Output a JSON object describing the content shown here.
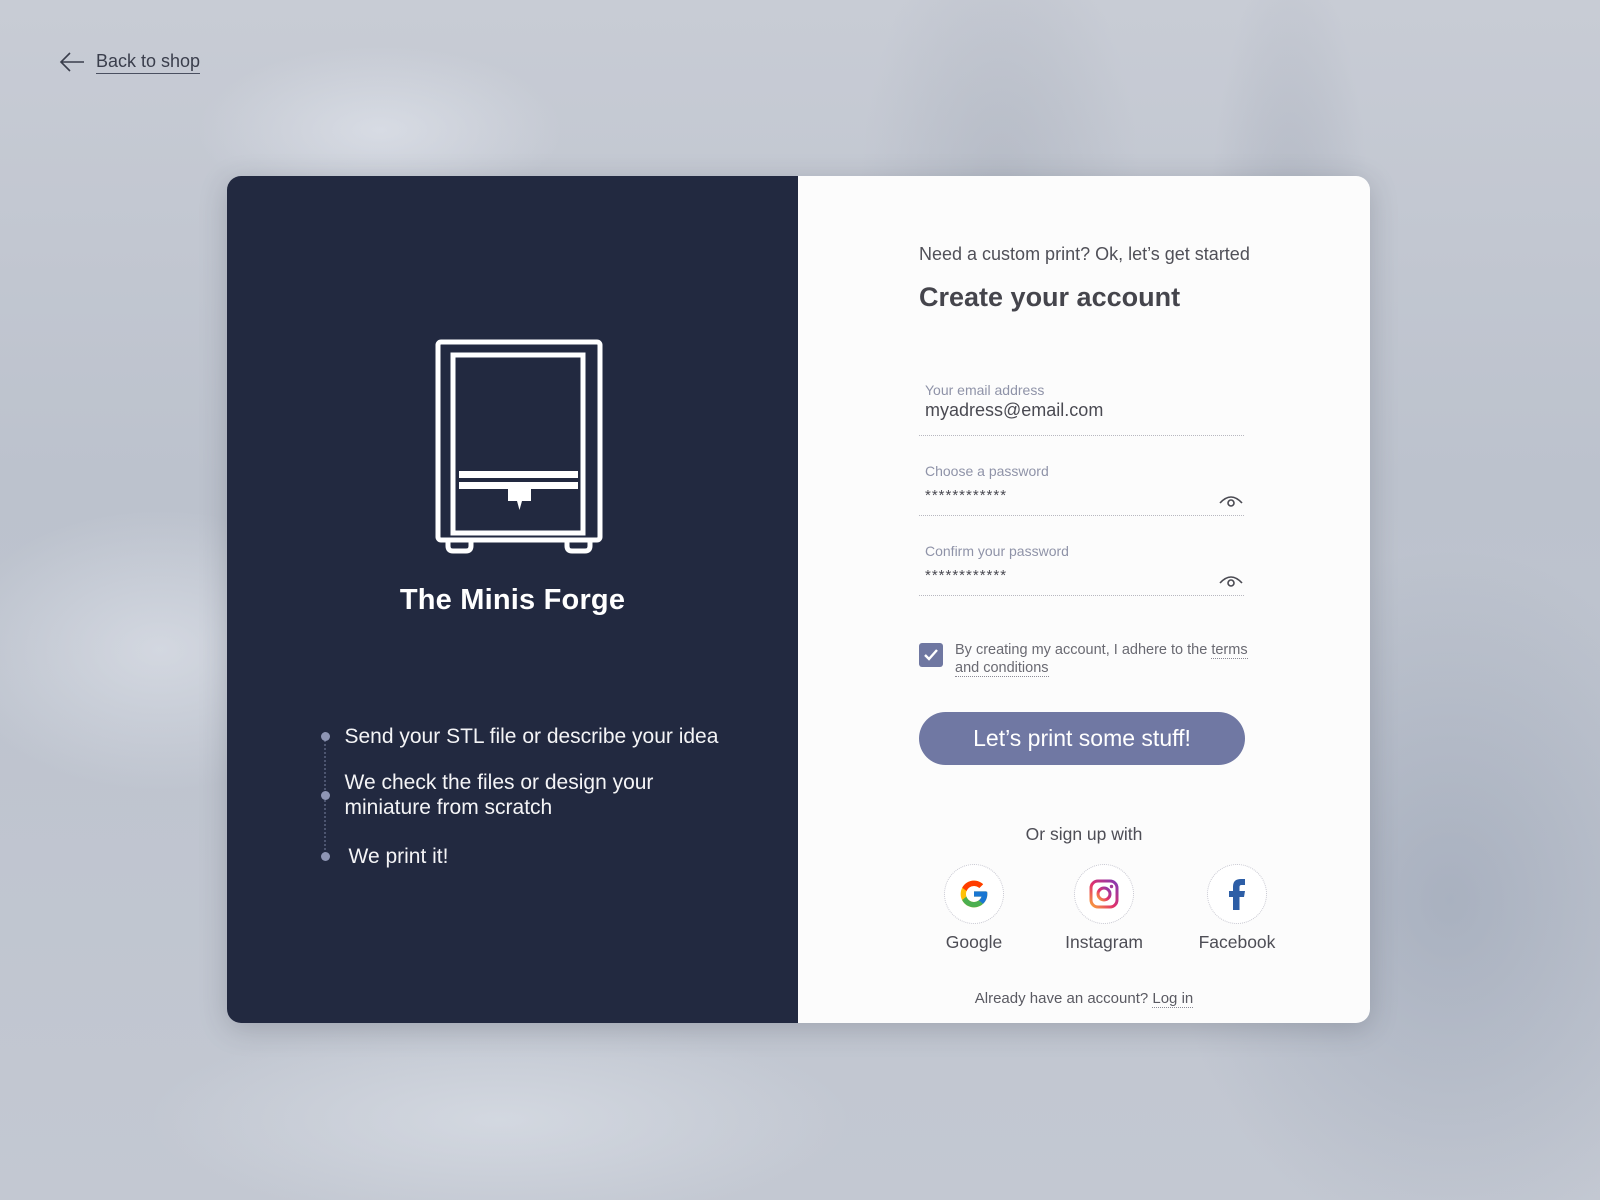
{
  "nav": {
    "back_label": "Back to shop"
  },
  "brand": {
    "name": "The Minis Forge",
    "logo_icon": "3d-printer-icon",
    "steps": [
      {
        "text": "Send your STL file or describe your idea"
      },
      {
        "text": "We check the files or design your miniature from scratch"
      },
      {
        "text": "We print it!"
      }
    ]
  },
  "form": {
    "subtitle": "Need a custom print? Ok, let’s get started",
    "title": "Create your account",
    "email": {
      "label": "Your email address",
      "value": "myadress@email.com"
    },
    "password": {
      "label": "Choose a password",
      "value": "************"
    },
    "confirm_password": {
      "label": "Confirm your password",
      "value": "************"
    },
    "terms": {
      "checked": true,
      "text": "By creating my account, I adhere to the ",
      "link": "terms and conditions"
    },
    "submit_label": "Let’s print some stuff!",
    "or_label": "Or sign up with",
    "social": [
      {
        "name": "Google",
        "icon": "google-icon"
      },
      {
        "name": "Instagram",
        "icon": "instagram-icon"
      },
      {
        "name": "Facebook",
        "icon": "facebook-icon"
      }
    ],
    "login_prompt": "Already have an account? ",
    "login_link": "Log in"
  },
  "colors": {
    "panel_dark": "#222940",
    "accent": "#7078a3",
    "panel_light": "#fcfcfc"
  }
}
